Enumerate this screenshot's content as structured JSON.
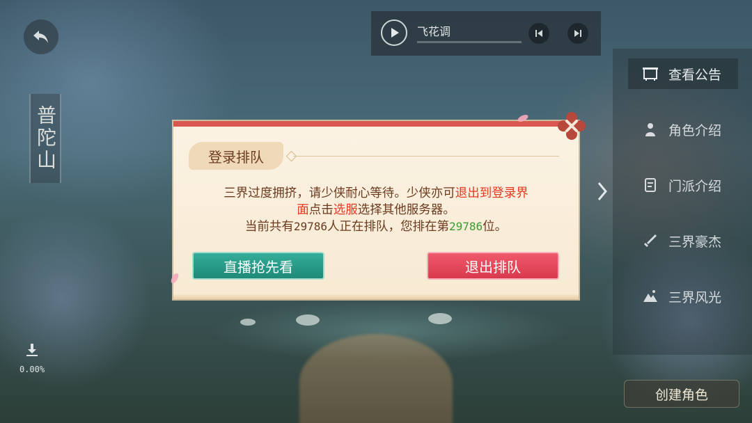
{
  "player": {
    "song_title": "飞花调",
    "progress": 0.0
  },
  "location": {
    "name": "普陀山"
  },
  "download": {
    "percent": "0.00%"
  },
  "side_menu": {
    "items": [
      {
        "label": "查看公告",
        "icon": "notice-board-icon"
      },
      {
        "label": "角色介绍",
        "icon": "character-icon"
      },
      {
        "label": "门派介绍",
        "icon": "scroll-icon"
      },
      {
        "label": "三界豪杰",
        "icon": "sword-icon"
      },
      {
        "label": "三界风光",
        "icon": "mountain-icon"
      }
    ]
  },
  "create_role": {
    "label": "创建角色"
  },
  "dialog": {
    "title": "登录排队",
    "line1_prefix": "三界过度拥挤，请少侠耐心等待。少侠亦可",
    "line1_link": "退出到登录界",
    "line2_link_cont": "面",
    "line2_mid": "点击",
    "line2_link2": "选服",
    "line2_suffix": "选择其他服务器。",
    "line3_prefix": "当前共有",
    "queue_total": "29786",
    "line3_mid": "人正在排队，您排在第",
    "queue_position": "29786",
    "line3_suffix": "位。",
    "watch_live_label": "直播抢先看",
    "exit_queue_label": "退出排队"
  },
  "colors": {
    "dialog_accent": "#d9574e",
    "link_red": "#e23a24",
    "position_green": "#3c9a2f",
    "green_button": "#1f8a78",
    "red_button": "#d83a4d"
  }
}
